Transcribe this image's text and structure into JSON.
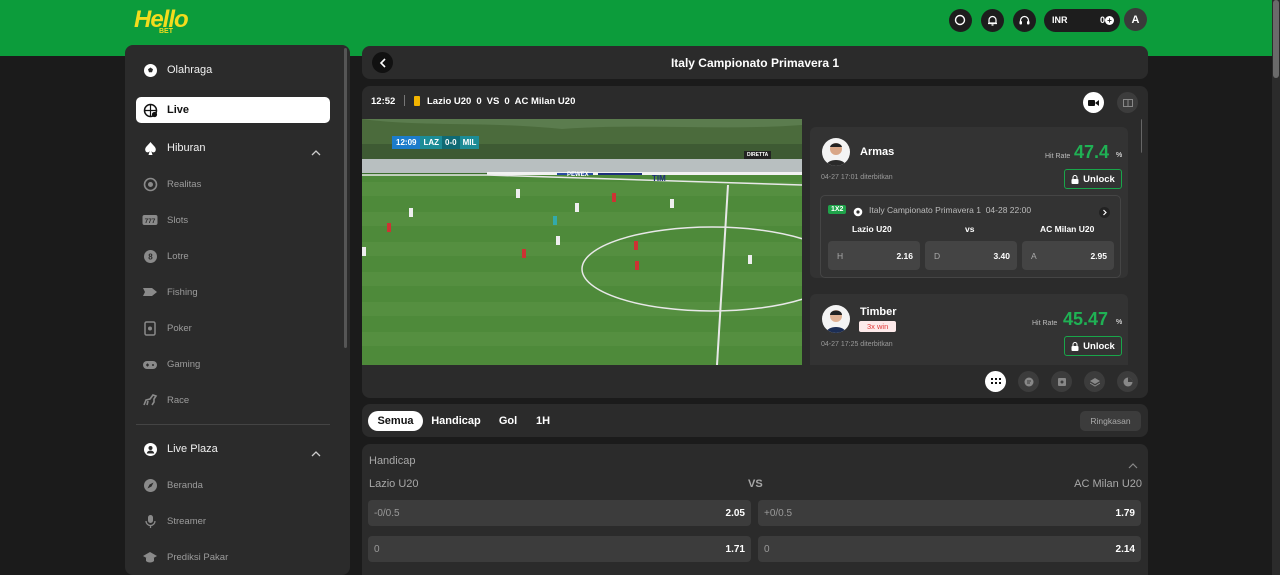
{
  "brand": {
    "logo_text": "Hello",
    "logo_sub": "BET"
  },
  "topbar": {
    "icons": [
      "search-icon",
      "bell-icon",
      "headset-icon"
    ],
    "currency": "INR",
    "balance": "0",
    "avatar_letter": "A"
  },
  "sidebar": {
    "items": [
      {
        "label": "Olahraga",
        "icon": "football-icon"
      },
      {
        "label": "Live",
        "icon": "live-globe-icon"
      },
      {
        "label": "Hiburan",
        "icon": "spade-icon"
      },
      {
        "label": "Realitas",
        "icon": "chip-icon"
      },
      {
        "label": "Slots",
        "icon": "slot-777-icon"
      },
      {
        "label": "Lotre",
        "icon": "lottery-ball-icon"
      },
      {
        "label": "Fishing",
        "icon": "fish-icon"
      },
      {
        "label": "Poker",
        "icon": "poker-card-icon"
      },
      {
        "label": "Gaming",
        "icon": "gamepad-icon"
      },
      {
        "label": "Race",
        "icon": "horse-icon"
      },
      {
        "label": "Live Plaza",
        "icon": "live-plaza-icon"
      },
      {
        "label": "Beranda",
        "icon": "compass-icon"
      },
      {
        "label": "Streamer",
        "icon": "microphone-icon"
      },
      {
        "label": "Prediksi Pakar",
        "icon": "graduation-cap-icon"
      }
    ]
  },
  "main": {
    "title": "Italy Campionato Primavera 1",
    "match": {
      "time": "12:52",
      "home": "Lazio U20",
      "home_score": "0",
      "vs": "VS",
      "away_score": "0",
      "away": "AC Milan U20"
    },
    "video": {
      "score_time": "12:09",
      "score_home": "LAZ",
      "score": "0-0",
      "score_away": "MIL",
      "ads": [
        "PEWEX",
        "TIM"
      ],
      "logo": "DIRETTA"
    },
    "tips": [
      {
        "name": "Armas",
        "badge": "",
        "date": "04-27 17:01 diterbitkan",
        "hit_label": "Hit Rate",
        "hit_rate": "47.4",
        "pct": "%",
        "unlock": "Unlock",
        "odds": {
          "market": "1X2",
          "league": "Italy Campionato Primavera 1",
          "datetime": "04-28 22:00",
          "home": "Lazio U20",
          "vs": "vs",
          "away": "AC Milan U20",
          "options": [
            {
              "k": "H",
              "v": "2.16"
            },
            {
              "k": "D",
              "v": "3.40"
            },
            {
              "k": "A",
              "v": "2.95"
            }
          ]
        }
      },
      {
        "name": "Timber",
        "badge": "3x win",
        "date": "04-27 17:25 diterbitkan",
        "hit_label": "Hit Rate",
        "hit_rate": "45.47",
        "pct": "%",
        "unlock": "Unlock"
      }
    ],
    "tools": [
      "grid-icon",
      "chat-icon",
      "lineup-icon",
      "layers-icon",
      "pie-chart-icon"
    ],
    "market_tabs": [
      "Semua",
      "Handicap",
      "Gol",
      "1H"
    ],
    "ringkasan": "Ringkasan",
    "handicap": {
      "title": "Handicap",
      "home": "Lazio U20",
      "vs": "VS",
      "away": "AC Milan U20",
      "rows": [
        {
          "home_line": "-0/0.5",
          "home_odds": "2.05",
          "away_line": "+0/0.5",
          "away_odds": "1.79"
        },
        {
          "home_line": "0",
          "home_odds": "1.71",
          "away_line": "0",
          "away_odds": "2.14"
        }
      ]
    }
  },
  "colors": {
    "brand_green": "#0c9c3b",
    "logo_yellow": "#f3dc1d",
    "hit_green": "#1fb154",
    "panel": "#2b2b2b",
    "bg": "#1b1b1b"
  }
}
